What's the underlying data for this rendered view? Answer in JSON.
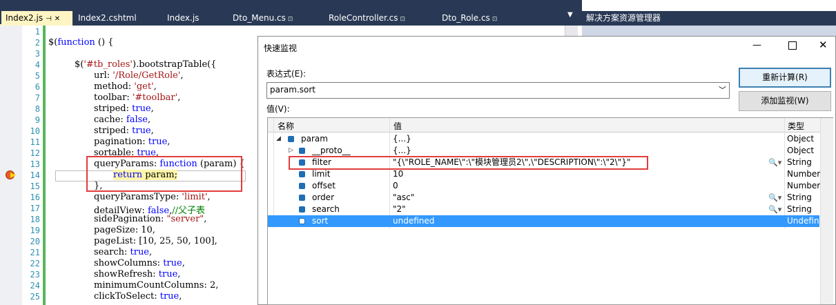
{
  "tabs": [
    {
      "label": "Index2.js",
      "pin": "⊣",
      "close": "✕"
    },
    {
      "label": "Index2.cshtml"
    },
    {
      "label": "Index.js"
    },
    {
      "label": "Dto_Menu.cs",
      "lock": "⊡"
    },
    {
      "label": "RoleController.cs",
      "lock": "⊡"
    },
    {
      "label": "Dto_Role.cs",
      "lock": "⊡"
    }
  ],
  "solution_explorer_title": "解决方案资源管理器",
  "line_numbers": [
    "1",
    "2",
    "3",
    "4",
    "5",
    "6",
    "7",
    "8",
    "9",
    "10",
    "11",
    "12",
    "13",
    "14",
    "15",
    "16",
    "17",
    "18",
    "19",
    "20",
    "21",
    "22",
    "23",
    "24",
    "25"
  ],
  "code": {
    "l2": [
      "$(",
      "function",
      " () {"
    ],
    "l4": [
      "$(",
      "'#tb_roles'",
      ").bootstrapTable({"
    ],
    "l5": [
      "url: ",
      "'/Role/GetRole'",
      ","
    ],
    "l6": [
      "method: ",
      "'get'",
      ","
    ],
    "l7": [
      "toolbar: ",
      "'#toolbar'",
      ","
    ],
    "l8": [
      "striped: ",
      "true",
      ","
    ],
    "l9": [
      "cache: ",
      "false",
      ","
    ],
    "l10": [
      "striped: ",
      "true",
      ","
    ],
    "l11": [
      "pagination: ",
      "true",
      ","
    ],
    "l12": [
      "sortable: ",
      "true",
      ","
    ],
    "l13": [
      "queryParams: ",
      "function",
      " (param) {"
    ],
    "l14": [
      "return",
      " param;"
    ],
    "l15": "},",
    "l16": [
      "queryParamsType: ",
      "'limit'",
      ","
    ],
    "l17": [
      "detailView: ",
      "false",
      ",",
      "//父子表"
    ],
    "l18": [
      "sidePagination: ",
      "\"server\"",
      ","
    ],
    "l19": "pageSize: 10,",
    "l20": "pageList: [10, 25, 50, 100],",
    "l21": [
      "search: ",
      "true",
      ","
    ],
    "l22": [
      "showColumns: ",
      "true",
      ","
    ],
    "l23": [
      "showRefresh: ",
      "true",
      ","
    ],
    "l24": "minimumCountColumns: 2,",
    "l25": [
      "clickToSelect: ",
      "true",
      ","
    ]
  },
  "dialog": {
    "title": "快速监视",
    "minimize": "—",
    "close": "✕",
    "expression_label": "表达式(E):",
    "expression_value": "param.sort",
    "value_label": "值(V):",
    "recalc_button": "重新计算(R)",
    "add_watch_button": "添加监视(W)",
    "columns": [
      "名称",
      "值",
      "类型"
    ],
    "rows": [
      {
        "name": "param",
        "value": "{...}",
        "type": "Object",
        "expander": "◢"
      },
      {
        "name": "__proto__",
        "value": "{...}",
        "type": "Object",
        "expander": "▷"
      },
      {
        "name": "filter",
        "value": "\"{\\\"ROLE_NAME\\\":\\\"模块管理员2\\\",\\\"DESCRIPTION\\\":\\\"2\\\"}\"",
        "type": "String"
      },
      {
        "name": "limit",
        "value": "10",
        "type": "Number"
      },
      {
        "name": "offset",
        "value": "0",
        "type": "Number"
      },
      {
        "name": "order",
        "value": "\"asc\"",
        "type": "String"
      },
      {
        "name": "search",
        "value": "\"2\"",
        "type": "String"
      },
      {
        "name": "sort",
        "value": "undefined",
        "type": "Undefine"
      }
    ]
  },
  "colors": {
    "tab_bg": "#293955",
    "active_tab": "#fff5c4",
    "selection": "#3399ff",
    "highlight_box": "#e33b3b"
  }
}
